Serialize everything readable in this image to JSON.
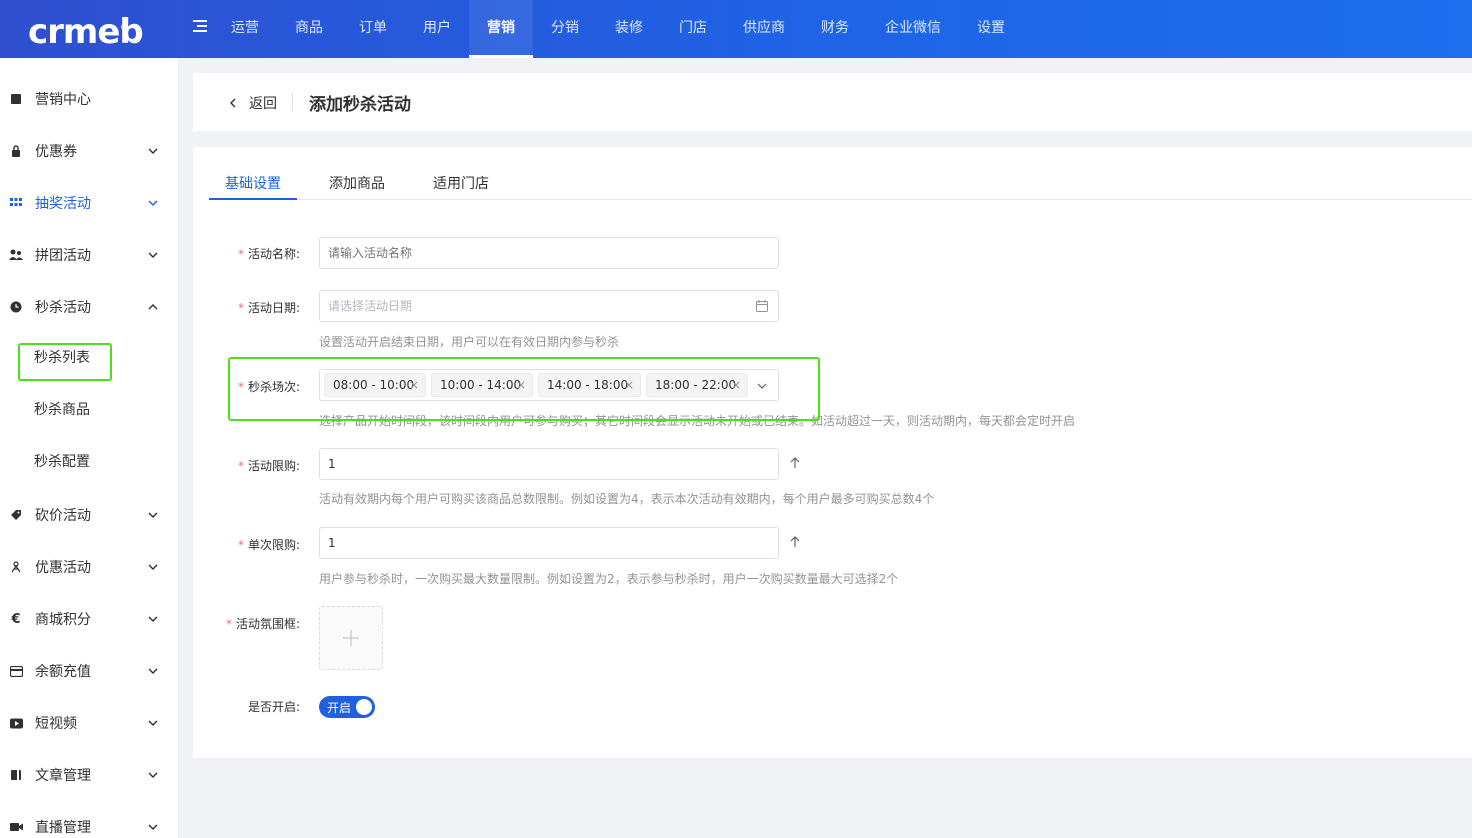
{
  "brand": {
    "logo_text": "crmeb"
  },
  "top_nav": [
    {
      "label": "运营"
    },
    {
      "label": "商品"
    },
    {
      "label": "订单"
    },
    {
      "label": "用户"
    },
    {
      "label": "营销"
    },
    {
      "label": "分销"
    },
    {
      "label": "装修"
    },
    {
      "label": "门店"
    },
    {
      "label": "供应商"
    },
    {
      "label": "财务"
    },
    {
      "label": "企业微信"
    },
    {
      "label": "设置"
    }
  ],
  "top_nav_active": "营销",
  "sidebar": {
    "items": [
      {
        "label": "营销中心",
        "icon": "book-icon"
      },
      {
        "label": "优惠券",
        "icon": "lock-icon"
      },
      {
        "label": "抽奖活动",
        "icon": "grid-icon"
      },
      {
        "label": "拼团活动",
        "icon": "group-icon"
      },
      {
        "label": "秒杀活动",
        "icon": "clock-icon"
      },
      {
        "label": "砍价活动",
        "icon": "tag-icon"
      },
      {
        "label": "优惠活动",
        "icon": "gift-icon"
      },
      {
        "label": "商城积分",
        "icon": "euro-icon"
      },
      {
        "label": "余额充值",
        "icon": "card-icon"
      },
      {
        "label": "短视频",
        "icon": "video-icon"
      },
      {
        "label": "文章管理",
        "icon": "article-icon"
      },
      {
        "label": "直播管理",
        "icon": "camera-icon"
      }
    ],
    "sub_items": [
      {
        "label": "秒杀列表"
      },
      {
        "label": "秒杀商品"
      },
      {
        "label": "秒杀配置"
      }
    ]
  },
  "header": {
    "back_label": "返回",
    "title": "添加秒杀活动"
  },
  "tabs": [
    {
      "label": "基础设置"
    },
    {
      "label": "添加商品"
    },
    {
      "label": "适用门店"
    }
  ],
  "form": {
    "name": {
      "label": "活动名称:",
      "placeholder": "请输入活动名称"
    },
    "date": {
      "label": "活动日期:",
      "placeholder": "请选择活动日期",
      "help": "设置活动开启结束日期，用户可以在有效日期内参与秒杀"
    },
    "slots": {
      "label": "秒杀场次:",
      "tags": [
        "08:00 - 10:00",
        "10:00 - 14:00",
        "14:00 - 18:00",
        "18:00 - 22:00"
      ],
      "help": "选择产品开始时间段，该时间段内用户可参与购买；其它时间段会显示活动未开始或已结束。如活动超过一天，则活动期内，每天都会定时开启"
    },
    "total_limit": {
      "label": "活动限购:",
      "value": "1",
      "help": "活动有效期内每个用户可购买该商品总数限制。例如设置为4，表示本次活动有效期内，每个用户最多可购买总数4个"
    },
    "single_limit": {
      "label": "单次限购:",
      "value": "1",
      "help": "用户参与秒杀时，一次购买最大数量限制。例如设置为2，表示参与秒杀时，用户一次购买数量最大可选择2个"
    },
    "frame": {
      "label": "活动氛围框:"
    },
    "enabled": {
      "label": "是否开启:",
      "toggle_text": "开启"
    }
  },
  "colors": {
    "primary": "#1f5fe0",
    "highlight": "#4de01a",
    "required": "#f56c6c"
  }
}
